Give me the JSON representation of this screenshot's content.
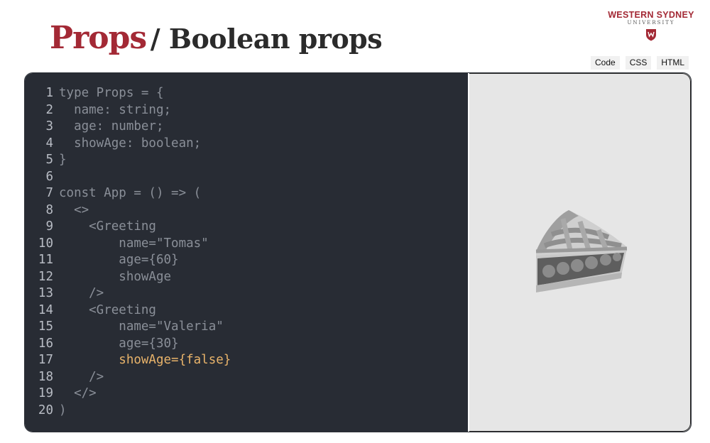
{
  "title": {
    "main": "Props",
    "sub": "/ Boolean props"
  },
  "logo": {
    "line1": "WESTERN SYDNEY",
    "line2": "UNIVERSITY"
  },
  "tabs": [
    "Code",
    "CSS",
    "HTML"
  ],
  "code": {
    "lines": [
      {
        "n": "1",
        "text": "type Props = {"
      },
      {
        "n": "2",
        "text": "  name: string;"
      },
      {
        "n": "3",
        "text": "  age: number;"
      },
      {
        "n": "4",
        "text": "  showAge: boolean;"
      },
      {
        "n": "5",
        "text": "}"
      },
      {
        "n": "6",
        "text": ""
      },
      {
        "n": "7",
        "text": "const App = () => ("
      },
      {
        "n": "8",
        "text": "  <>"
      },
      {
        "n": "9",
        "text": "    <Greeting"
      },
      {
        "n": "10",
        "text": "        name=\"Tomas\""
      },
      {
        "n": "11",
        "text": "        age={60}"
      },
      {
        "n": "12",
        "text": "        showAge"
      },
      {
        "n": "13",
        "text": "    />"
      },
      {
        "n": "14",
        "text": "    <Greeting"
      },
      {
        "n": "15",
        "text": "        name=\"Valeria\""
      },
      {
        "n": "16",
        "text": "        age={30}"
      },
      {
        "n": "17",
        "text": "        showAge={false}"
      },
      {
        "n": "18",
        "text": "    />"
      },
      {
        "n": "19",
        "text": "  </>"
      },
      {
        "n": "20",
        "text": ")"
      }
    ],
    "highlighted_line": "17"
  },
  "preview": {
    "icon": "pie-icon"
  },
  "colors": {
    "brand": "#a32935",
    "editor_bg": "#282c34",
    "preview_bg": "#e6e6e6",
    "highlight": "#e8b36a"
  }
}
